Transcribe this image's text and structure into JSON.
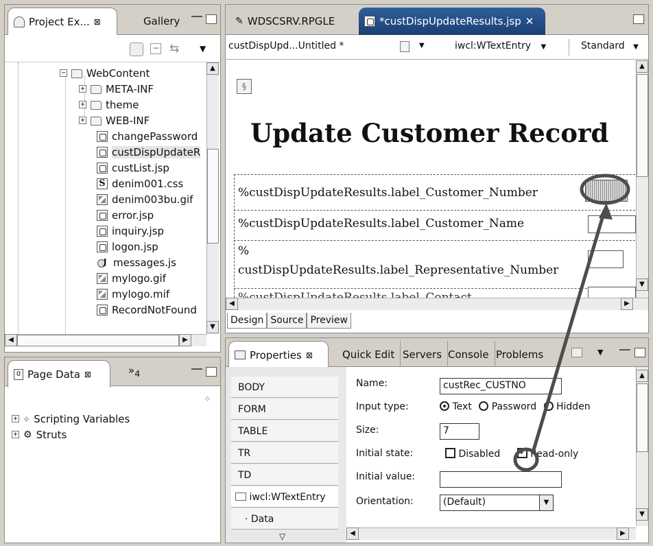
{
  "project_explorer": {
    "tab_label": "Project Ex...",
    "gallery_tab": "Gallery",
    "tree": [
      {
        "label": "WebContent",
        "kind": "folder",
        "expander": "−"
      },
      {
        "label": "META-INF",
        "kind": "folder",
        "expander": "+"
      },
      {
        "label": "theme",
        "kind": "folder",
        "expander": "+"
      },
      {
        "label": "WEB-INF",
        "kind": "folder",
        "expander": "+"
      },
      {
        "label": "changePassword",
        "kind": "jsp"
      },
      {
        "label": "custDispUpdateR",
        "kind": "jsp",
        "selected": true
      },
      {
        "label": "custList.jsp",
        "kind": "jsp"
      },
      {
        "label": "denim001.css",
        "kind": "css"
      },
      {
        "label": "denim003bu.gif",
        "kind": "gif"
      },
      {
        "label": "error.jsp",
        "kind": "jsp"
      },
      {
        "label": "inquiry.jsp",
        "kind": "jsp"
      },
      {
        "label": "logon.jsp",
        "kind": "jsp"
      },
      {
        "label": "messages.js",
        "kind": "js"
      },
      {
        "label": "mylogo.gif",
        "kind": "gif"
      },
      {
        "label": "mylogo.mif",
        "kind": "gif"
      },
      {
        "label": "RecordNotFound",
        "kind": "jsp"
      }
    ]
  },
  "page_data": {
    "tab_label": "Page Data",
    "overflow_label": "»",
    "overflow_count": "4",
    "items": [
      "Scripting Variables",
      "Struts"
    ]
  },
  "editor": {
    "tabs": [
      "WDSCSRV.RPGLE",
      "*custDispUpdateResults.jsp"
    ],
    "close_glyph": "✕",
    "breadcrumb": "custDispUpd...Untitled *",
    "tag_selector": "iwcl:WTextEntry",
    "style_selector": "Standard",
    "page_heading": "Update Customer Record",
    "rows": [
      "%custDispUpdateResults.label_Customer_Number",
      "%custDispUpdateResults.label_Customer_Name",
      "%",
      "custDispUpdateResults.label_Representative_Number",
      "%custDispUpdateResults.label_Contact"
    ],
    "bottom_tabs": [
      "Design",
      "Source",
      "Preview"
    ]
  },
  "properties": {
    "tabs": [
      "Properties",
      "Quick Edit",
      "Servers",
      "Console",
      "Problems"
    ],
    "left_tabs": [
      "BODY",
      "FORM",
      "TABLE",
      "TR",
      "TD",
      "iwcl:WTextEntry",
      "Data"
    ],
    "labels": {
      "name": "Name:",
      "input_type": "Input type:",
      "size": "Size:",
      "initial_state": "Initial state:",
      "initial_value": "Initial value:",
      "orientation": "Orientation:"
    },
    "values": {
      "name": "custRec_CUSTNO",
      "size": "7",
      "initial_value": "",
      "orientation": "(Default)"
    },
    "input_type_options": [
      "Text",
      "Password",
      "Hidden"
    ],
    "selected_input_type": "Text",
    "state_options": [
      "Disabled",
      "Read-only"
    ],
    "checked_state": "Read-only"
  },
  "colors": {
    "annotation": "#4d4d4d",
    "active_tab": "#1b3f73"
  }
}
